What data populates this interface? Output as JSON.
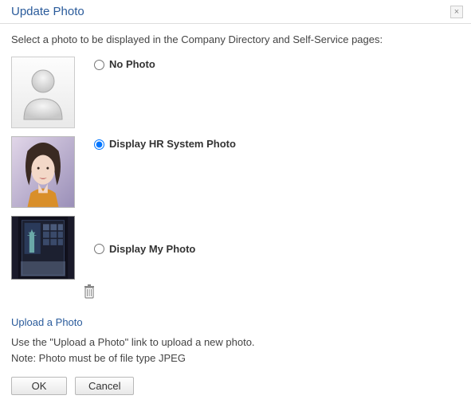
{
  "dialog": {
    "title": "Update Photo",
    "close_glyph": "×"
  },
  "instruction": "Select a photo to be displayed in the Company Directory and Self-Service pages:",
  "options": {
    "no_photo": {
      "label": "No Photo"
    },
    "hr_photo": {
      "label": "Display HR System Photo"
    },
    "my_photo": {
      "label": "Display My Photo"
    }
  },
  "upload_link": "Upload a Photo",
  "help_line1": "Use the \"Upload a Photo\" link to upload a new photo.",
  "help_line2": "Note: Photo must be of file type JPEG",
  "buttons": {
    "ok": "OK",
    "cancel": "Cancel"
  }
}
